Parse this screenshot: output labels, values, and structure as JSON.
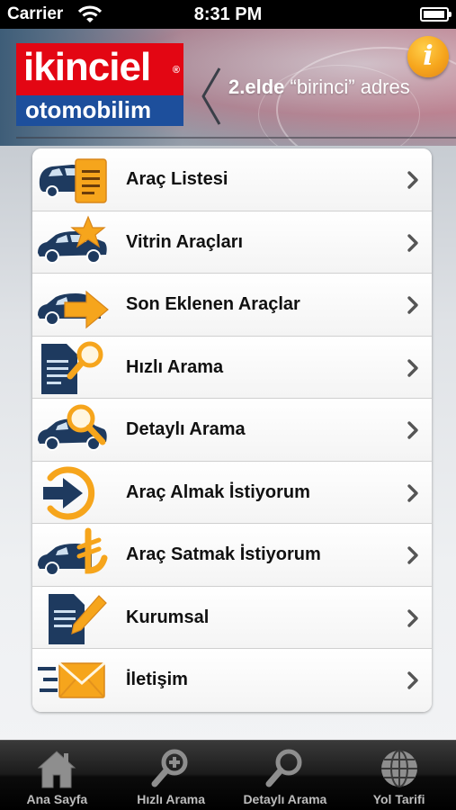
{
  "status_bar": {
    "carrier": "Carrier",
    "time": "8:31 PM",
    "battery_level": 0.95
  },
  "header": {
    "logo_line1": "ikinciel",
    "logo_registered": "®",
    "logo_line2": "otomobilim",
    "slogan_bold": "2.elde",
    "slogan_rest": " “birinci” adres",
    "info_button_label": "i"
  },
  "menu": {
    "items": [
      {
        "label": "Araç Listesi",
        "icon": "car-list-icon"
      },
      {
        "label": "Vitrin Araçları",
        "icon": "car-star-icon"
      },
      {
        "label": "Son Eklenen Araçlar",
        "icon": "car-arrow-icon"
      },
      {
        "label": "Hızlı Arama",
        "icon": "document-magnifier-icon"
      },
      {
        "label": "Detaylı Arama",
        "icon": "car-magnifier-icon"
      },
      {
        "label": "Araç Almak İstiyorum",
        "icon": "circle-arrow-icon"
      },
      {
        "label": "Araç Satmak İstiyorum",
        "icon": "car-lira-icon"
      },
      {
        "label": "Kurumsal",
        "icon": "document-pencil-icon"
      },
      {
        "label": "İletişim",
        "icon": "envelope-icon"
      }
    ]
  },
  "tab_bar": {
    "tabs": [
      {
        "label": "Ana Sayfa",
        "icon": "home-icon"
      },
      {
        "label": "Hızlı Arama",
        "icon": "zoom-in-icon"
      },
      {
        "label": "Detaylı Arama",
        "icon": "search-icon"
      },
      {
        "label": "Yol Tarifi",
        "icon": "globe-icon"
      }
    ]
  },
  "colors": {
    "brand_red": "#e30613",
    "brand_blue": "#1d4f9c",
    "accent_orange": "#f6a51c",
    "icon_navy": "#1e3a5f"
  }
}
